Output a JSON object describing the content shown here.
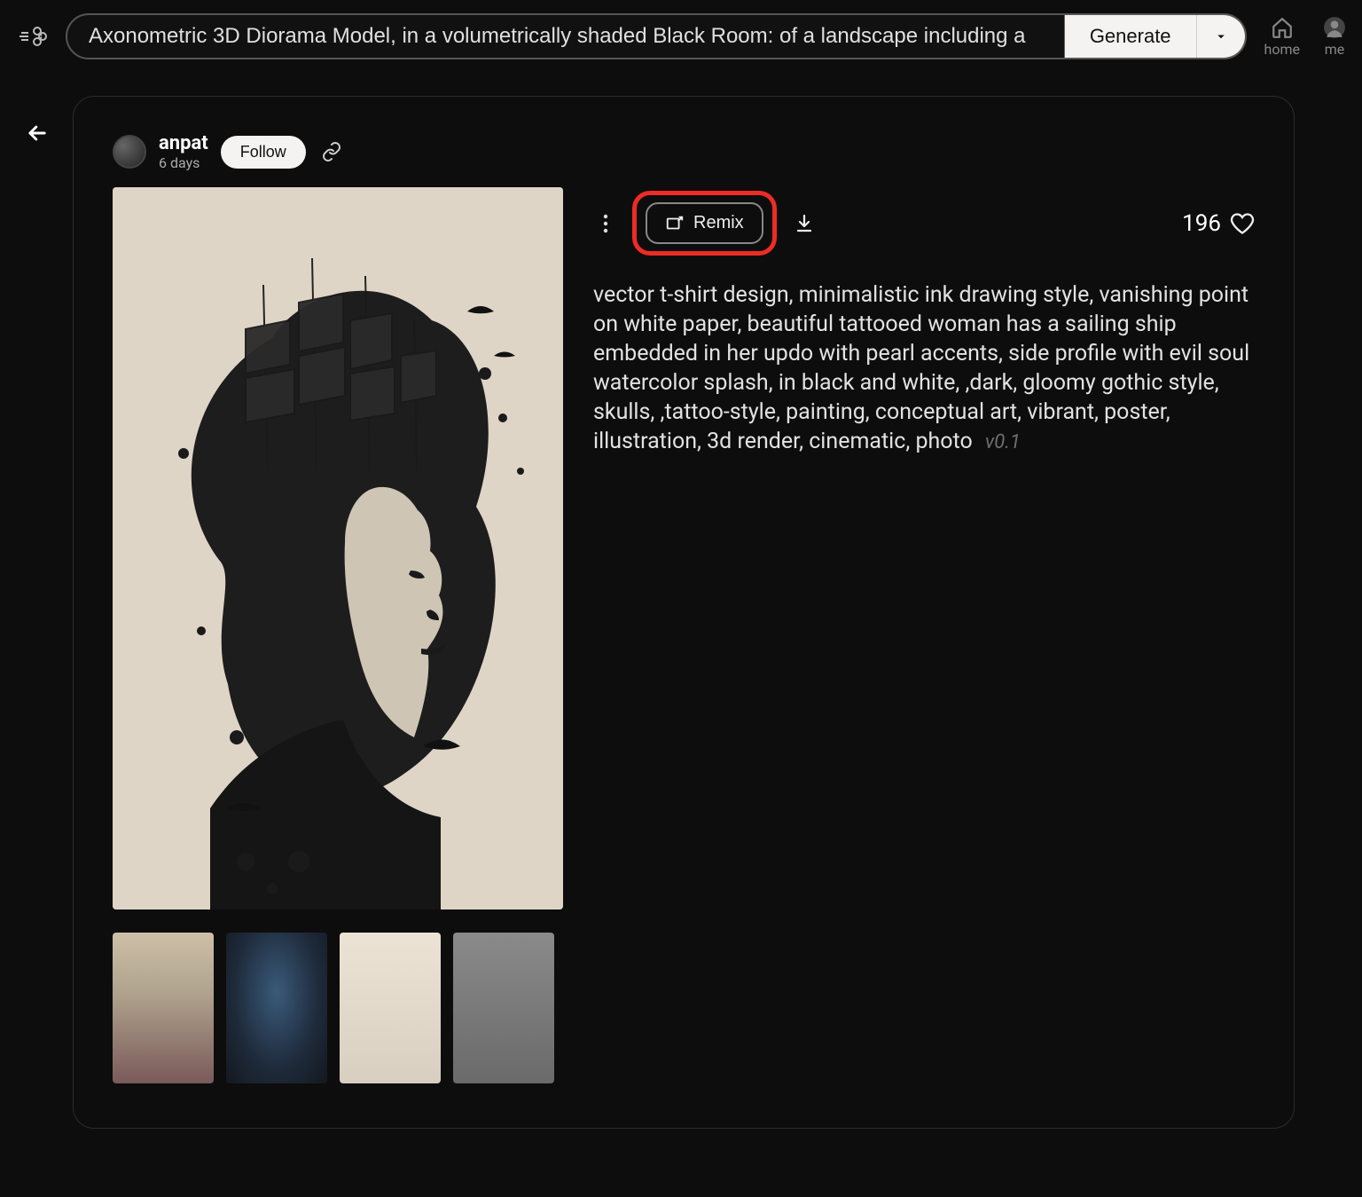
{
  "header": {
    "search_value": "Axonometric 3D Diorama Model, in a volumetrically shaded Black Room: of a landscape including a",
    "generate_label": "Generate",
    "nav": {
      "home": "home",
      "me": "me"
    }
  },
  "post": {
    "author": {
      "name": "anpat",
      "time": "6 days"
    },
    "follow_label": "Follow",
    "remix_label": "Remix",
    "likes": "196",
    "prompt": "vector t-shirt design, minimalistic ink drawing style, vanishing point on white paper, beautiful tattooed woman has a sailing ship embedded in her updo with pearl accents, side profile with evil soul watercolor splash, in black and white, ,dark, gloomy gothic style, skulls, ,tattoo-style, painting, conceptual art, vibrant, poster, illustration, 3d render, cinematic, photo",
    "version": "v0.1",
    "thumb_count": 4
  }
}
